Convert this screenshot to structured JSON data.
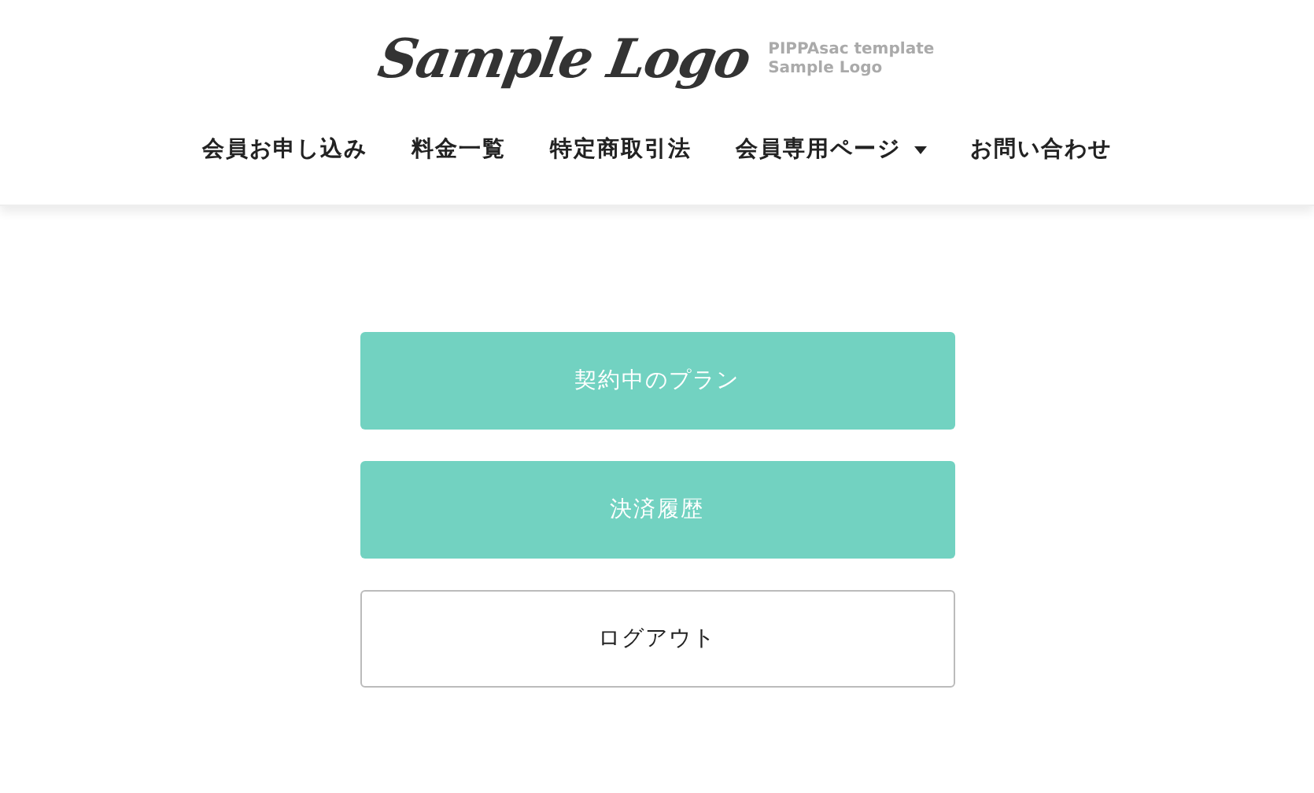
{
  "logo": {
    "text": "Sample Logo",
    "tagline": [
      "PIPPAsac template",
      "Sample Logo"
    ]
  },
  "nav": [
    {
      "label": "会員お申し込み",
      "has_dropdown": false
    },
    {
      "label": "料金一覧",
      "has_dropdown": false
    },
    {
      "label": "特定商取引法",
      "has_dropdown": false
    },
    {
      "label": "会員専用ページ",
      "has_dropdown": true
    },
    {
      "label": "お問い合わせ",
      "has_dropdown": false
    }
  ],
  "buttons": [
    {
      "label": "契約中のプラン",
      "kind": "filled"
    },
    {
      "label": "決済履歴",
      "kind": "filled"
    },
    {
      "label": "ログアウト",
      "kind": "outline"
    }
  ]
}
